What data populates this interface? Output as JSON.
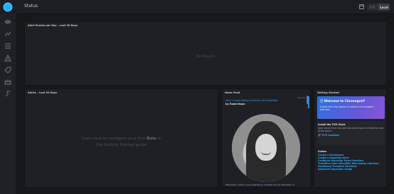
{
  "topbar": {
    "title": "Status",
    "tz_utc": "UTC",
    "tz_local": "Local"
  },
  "sidebar": {
    "items": [
      {
        "icon": "eye-icon"
      },
      {
        "icon": "graph-icon"
      },
      {
        "icon": "list-icon"
      },
      {
        "icon": "alert-icon"
      },
      {
        "icon": "tags-icon"
      },
      {
        "icon": "crown-icon"
      },
      {
        "icon": "wrench-icon"
      }
    ]
  },
  "panels": {
    "alert_events": {
      "header": "Alert Events per Day – Last 30 Days",
      "empty": "No Results"
    },
    "alerts": {
      "header": "Alerts – Last 30 Days",
      "msg_pre": "Learn how to configure your first ",
      "msg_rule": "Rule",
      "msg_mid": " in",
      "msg_line2_pre": "the ",
      "msg_guide": "Getting Started",
      "msg_line2_post": " guide"
    },
    "news": {
      "header": "News Feed",
      "date": "Aug 26",
      "title": "Why I Loved Being an Intern at InfluxData",
      "author": "by Rashi Bose",
      "body": "Whenever I start a new experience, whether it's an internship or"
    },
    "getting_started": {
      "header": "Getting Started",
      "welcome_title": "Welcome to Chronograf!",
      "welcome_sub": "Follow the links below to explore Chronograf's features.",
      "tick_title": "Install the TICK Stack",
      "tick_desc": "Save some time and use this handy tool to install the rest of the stack:",
      "tick_link": "TICK Sandbox",
      "guides_title": "Guides",
      "guides": [
        "Create a Dashboard",
        "Create a Kapacitor Alert",
        "Configure Kapacitor Event Handlers",
        "Transition from InfluxDB's Web Admin Interface",
        "Dashboard Template Variables",
        "Advanced Kapacitor Usage"
      ]
    }
  },
  "colors": {
    "accent": "#22adf6",
    "link": "#3ea4e5",
    "background": "#17181c",
    "panel": "#1f2025"
  }
}
